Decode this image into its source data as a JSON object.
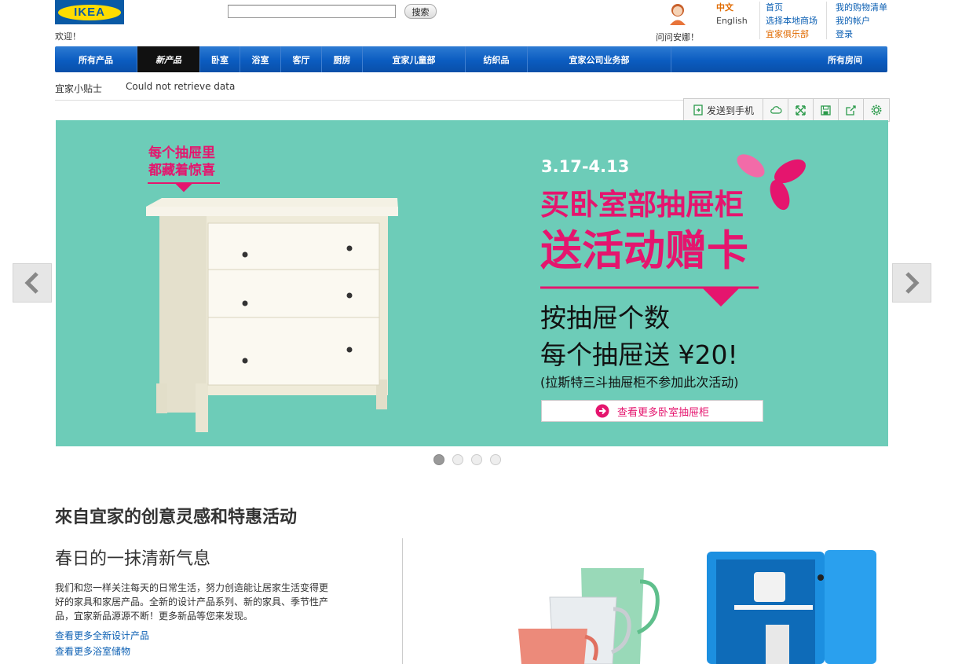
{
  "header": {
    "logo_text": "IKEA",
    "welcome": "欢迎！",
    "search": {
      "value": "",
      "placeholder": ""
    },
    "search_button": "搜索",
    "ask_anna": "问问安娜！",
    "lang_cn": "中文",
    "lang_en": "English",
    "links_col1": [
      "首页",
      "选择本地商场",
      "宜家俱乐部"
    ],
    "links_col2": [
      "我的购物清单",
      "我的帐户",
      "登录"
    ]
  },
  "nav": {
    "items": [
      "所有产品",
      "新产品",
      "卧室",
      "浴室",
      "客厅",
      "厨房",
      "宜家儿童部",
      "纺织品",
      "宜家公司业务部",
      "所有房间"
    ],
    "active_index": 1
  },
  "tips": {
    "label": "宜家小贴士",
    "message": "Could not retrieve data"
  },
  "toolbar": {
    "send_label": "发送到手机",
    "icons": [
      "cloud-icon",
      "expand-icon",
      "save-icon",
      "share-icon",
      "gear-icon"
    ]
  },
  "banner": {
    "tag_line1": "每个抽屉里",
    "tag_line2": "都藏着惊喜",
    "dates": "3.17-4.13",
    "headline1": "买卧室部抽屉柜",
    "headline2": "送活动赠卡",
    "offer1": "按抽屉个数",
    "offer2": "每个抽屉送 ¥20!",
    "note": "(拉斯特三斗抽屉柜不参加此次活动)",
    "cta": "查看更多卧室抽屉柜",
    "slide_count": 4,
    "active_slide": 1,
    "colors": {
      "background": "#6dccb8",
      "accent": "#e5156e"
    }
  },
  "section": {
    "title": "來自宜家的创意灵感和特惠活动",
    "promo_title": "春日的一抹清新气息",
    "promo_text": "我们和您一样关注每天的日常生活，努力创造能让居家生活变得更好的家具和家居产品。全新的设计产品系列、新的家具、季节性产品，宜家新品源源不断！更多新品等您来发现。",
    "links": [
      "查看更多全新设计产品",
      "查看更多浴室储物"
    ]
  }
}
